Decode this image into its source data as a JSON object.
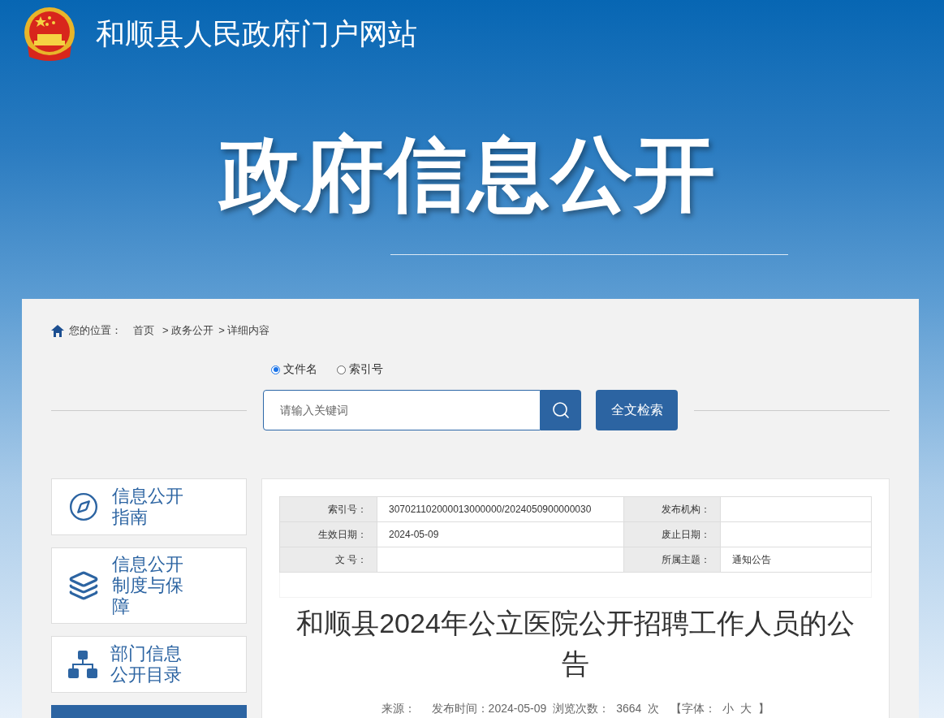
{
  "site": {
    "title": "和顺县人民政府门户网站"
  },
  "banner": {
    "title": "政府信息公开"
  },
  "breadcrumb": {
    "label": "您的位置：",
    "items": [
      "首页",
      "> 政务公开",
      "> 详细内容"
    ]
  },
  "search": {
    "options": [
      {
        "label": "文件名",
        "selected": true
      },
      {
        "label": "索引号",
        "selected": false
      }
    ],
    "placeholder": "请输入关键词",
    "fulltext_button": "全文检索"
  },
  "sidebar": {
    "items": [
      {
        "kind": "compass",
        "label": "信息公开指南",
        "selected": false
      },
      {
        "kind": "layers",
        "label": "信息公开制度与保障",
        "selected": false
      },
      {
        "kind": "sitemap",
        "label": "部门信息公开目录",
        "selected": false
      },
      {
        "kind": "blank",
        "selected": true
      }
    ]
  },
  "info_table": {
    "rows": [
      {
        "label_1": "索引号：",
        "value_1": "307021102000013000000/2024050900000030",
        "label_2": "发布机构：",
        "value_2": ""
      },
      {
        "label_1": "生效日期：",
        "value_1": "2024-05-09",
        "label_2": "废止日期：",
        "value_2": ""
      },
      {
        "label_1": "文 号：",
        "value_1": "",
        "label_2": "所属主题：",
        "value_2": "通知公告"
      }
    ]
  },
  "article": {
    "title": "和顺县2024年公立医院公开招聘工作人员的公告",
    "meta": [
      "来源：",
      "发布时间：2024-05-09",
      "浏览次数：",
      "3664",
      "次",
      "【字体：",
      "小",
      "大",
      "】"
    ]
  }
}
